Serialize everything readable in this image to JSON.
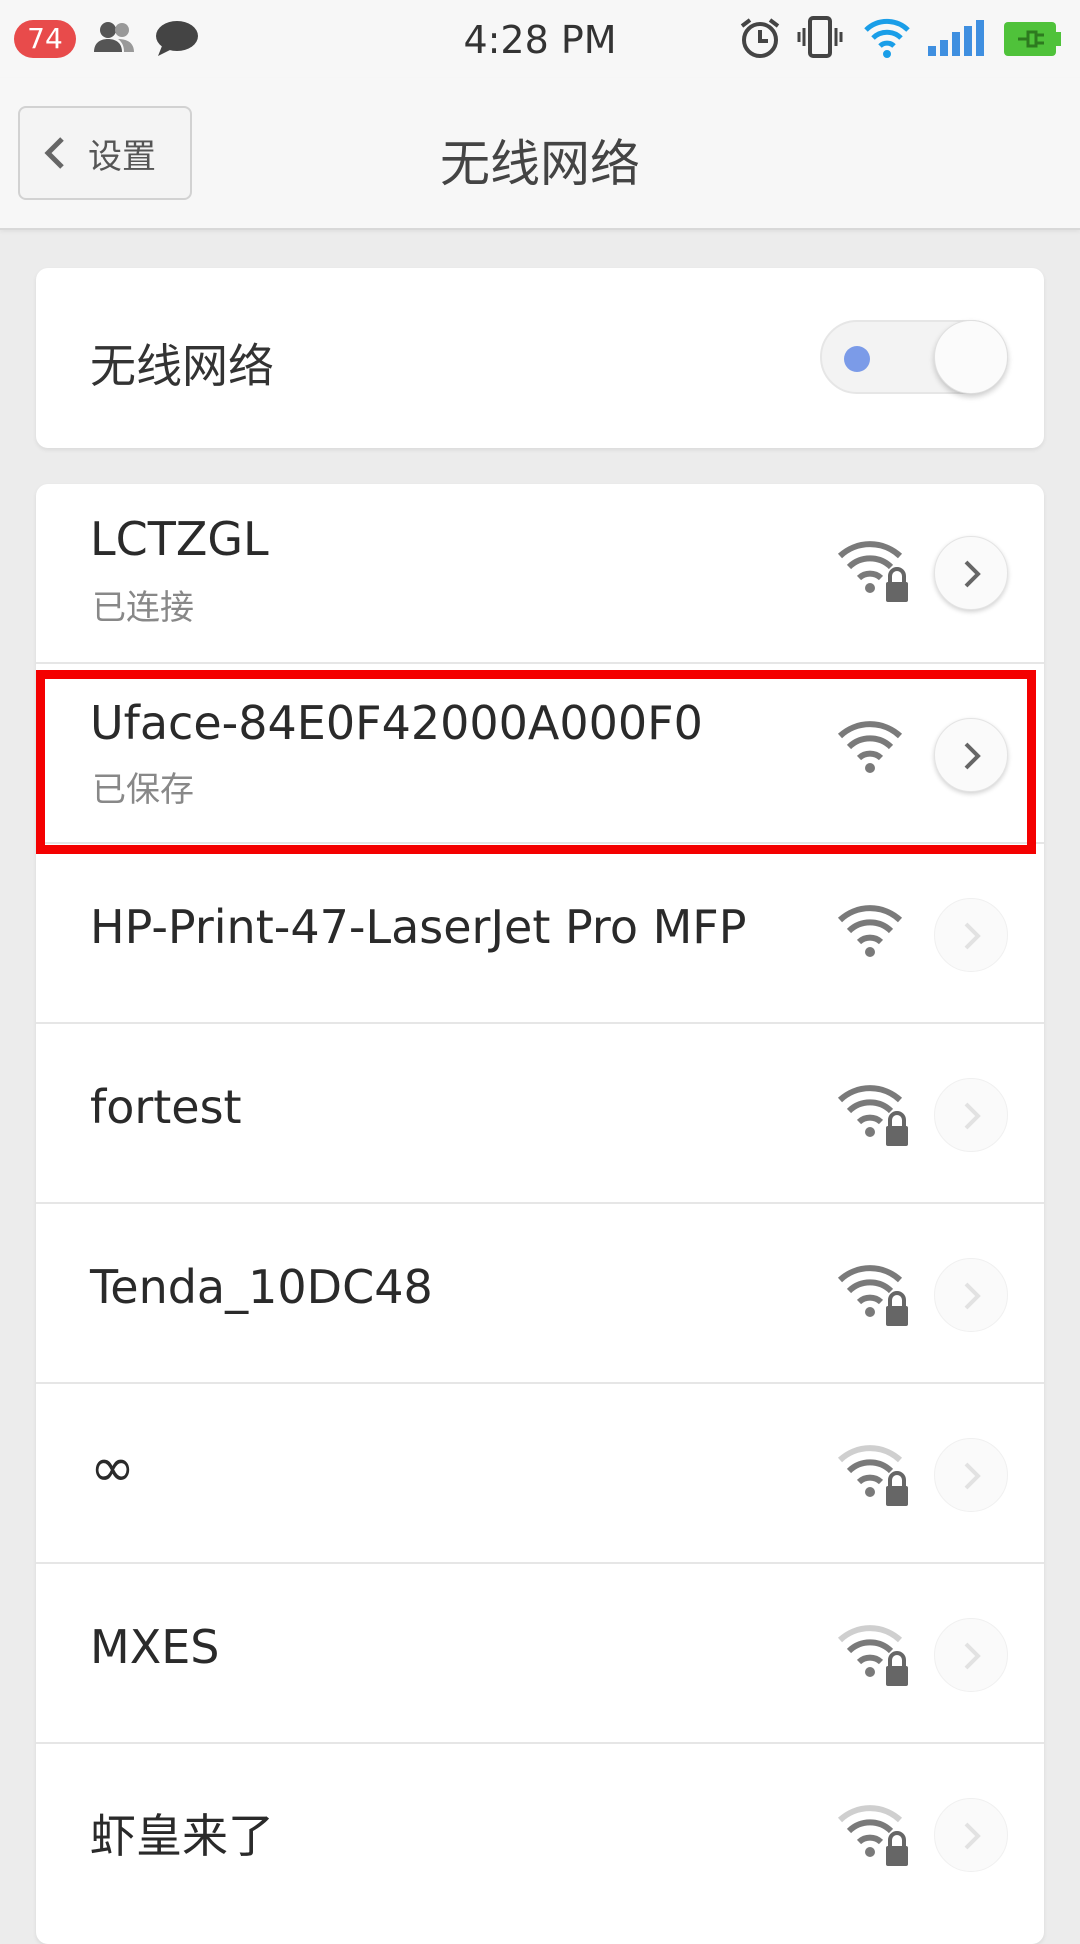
{
  "status_bar": {
    "notification_count": "74",
    "time": "4:28 PM",
    "icons": [
      "contacts-icon",
      "message-icon",
      "alarm-icon",
      "vibrate-icon",
      "wifi-icon",
      "signal-icon",
      "battery-charging-icon"
    ]
  },
  "header": {
    "back_label": "设置",
    "title": "无线网络"
  },
  "wifi_toggle": {
    "label": "无线网络",
    "enabled": true
  },
  "networks": [
    {
      "ssid": "LCTZGL",
      "status": "已连接",
      "secured": true,
      "signal": 3,
      "details_enabled": true
    },
    {
      "ssid": "Uface-84E0F42000A000F0",
      "status": "已保存",
      "secured": false,
      "signal": 3,
      "details_enabled": true
    },
    {
      "ssid": "HP-Print-47-LaserJet Pro MFP",
      "status": "",
      "secured": false,
      "signal": 3,
      "details_enabled": false
    },
    {
      "ssid": "fortest",
      "status": "",
      "secured": true,
      "signal": 3,
      "details_enabled": false
    },
    {
      "ssid": "Tenda_10DC48",
      "status": "",
      "secured": true,
      "signal": 3,
      "details_enabled": false
    },
    {
      "ssid": "∞",
      "status": "",
      "secured": true,
      "signal": 2,
      "details_enabled": false
    },
    {
      "ssid": "MXES",
      "status": "",
      "secured": true,
      "signal": 2,
      "details_enabled": false
    },
    {
      "ssid": "虾皇来了",
      "status": "",
      "secured": true,
      "signal": 2,
      "details_enabled": false
    }
  ],
  "colors": {
    "highlight": "#f40000",
    "toggle_dot": "#7b9be8",
    "wifi_active": "#1a9ee8",
    "battery": "#4fc23a",
    "badge": "#e84b4b"
  }
}
